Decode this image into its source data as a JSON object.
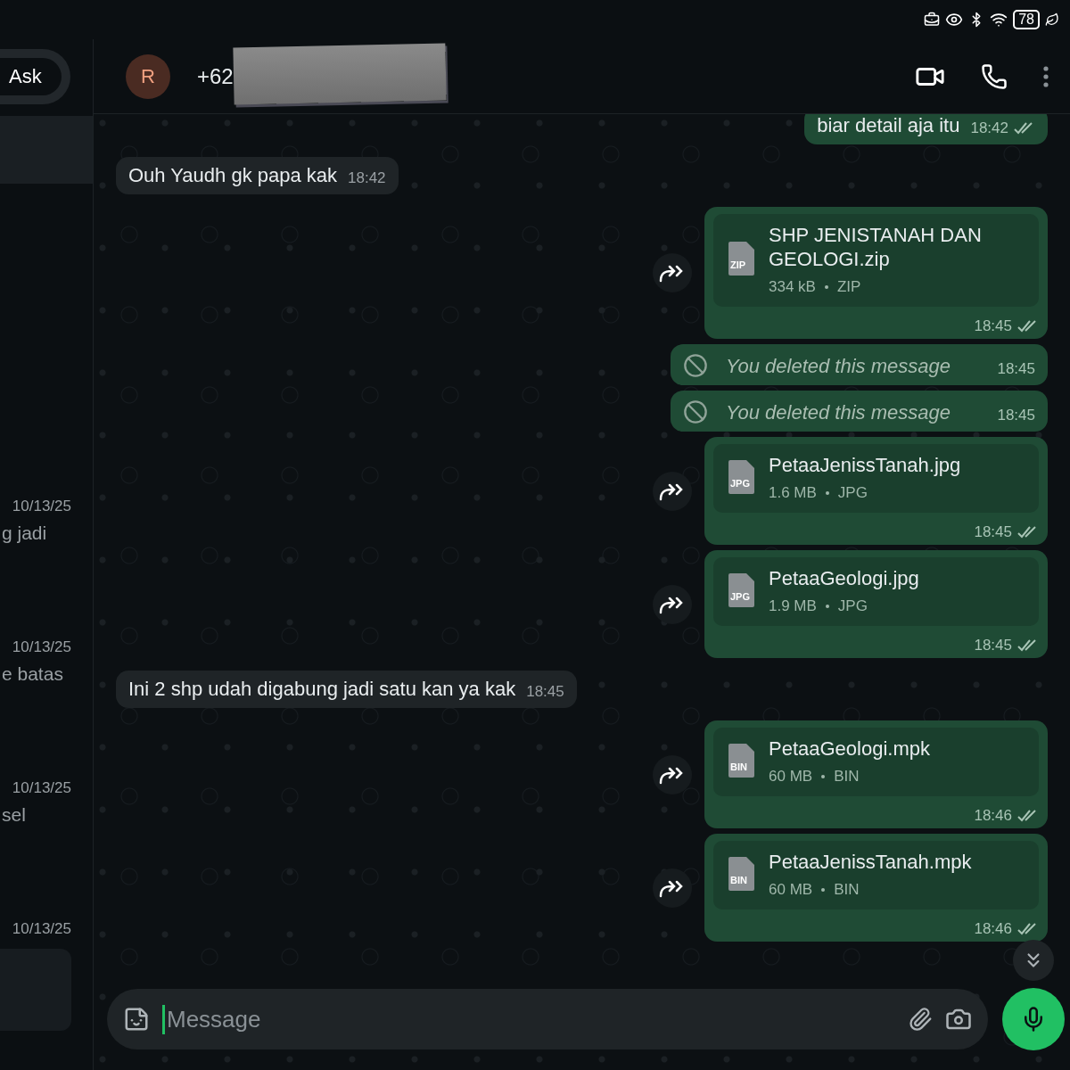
{
  "status_bar": {
    "battery": "78"
  },
  "sidebar": {
    "ask_button": "Ask",
    "chats": [
      {
        "selected": true
      },
      {
        "date": "10/13/25",
        "preview": "g jadi",
        "selected": false
      },
      {
        "date": "10/13/25",
        "preview": "e batas",
        "selected": false
      },
      {
        "date": "10/13/25",
        "preview": "sel",
        "selected": false
      },
      {
        "date": "10/13/25",
        "selected": false
      }
    ]
  },
  "header": {
    "avatar_letter": "R",
    "phone": "+62"
  },
  "messages": [
    {
      "kind": "text",
      "outgoing": true,
      "text": "biar detail aja itu",
      "time": "18:42",
      "read": false
    },
    {
      "kind": "text",
      "outgoing": false,
      "text": "Ouh Yaudh gk papa kak",
      "time": "18:42"
    },
    {
      "kind": "file",
      "outgoing": true,
      "name": "SHP JENISTANAH DAN GEOLOGI.zip",
      "icon_label": "ZIP",
      "size": "334 kB",
      "type": "ZIP",
      "time": "18:45",
      "read": false
    },
    {
      "kind": "deleted",
      "outgoing": true,
      "text": "You deleted this message",
      "time": "18:45"
    },
    {
      "kind": "deleted",
      "outgoing": true,
      "text": "You deleted this message",
      "time": "18:45"
    },
    {
      "kind": "file",
      "outgoing": true,
      "name": "PetaaJenissTanah.jpg",
      "icon_label": "JPG",
      "size": "1.6 MB",
      "type": "JPG",
      "time": "18:45",
      "read": false
    },
    {
      "kind": "file",
      "outgoing": true,
      "name": "PetaaGeologi.jpg",
      "icon_label": "JPG",
      "size": "1.9 MB",
      "type": "JPG",
      "time": "18:45",
      "read": false
    },
    {
      "kind": "text",
      "outgoing": false,
      "text": "Ini 2 shp udah digabung jadi satu kan ya kak",
      "time": "18:45"
    },
    {
      "kind": "file",
      "outgoing": true,
      "name": "PetaaGeologi.mpk",
      "icon_label": "BIN",
      "size": "60 MB",
      "type": "BIN",
      "time": "18:46",
      "read": false
    },
    {
      "kind": "file",
      "outgoing": true,
      "name": "PetaaJenissTanah.mpk",
      "icon_label": "BIN",
      "size": "60 MB",
      "type": "BIN",
      "time": "18:46",
      "read": false
    }
  ],
  "composer": {
    "placeholder": "Message"
  }
}
